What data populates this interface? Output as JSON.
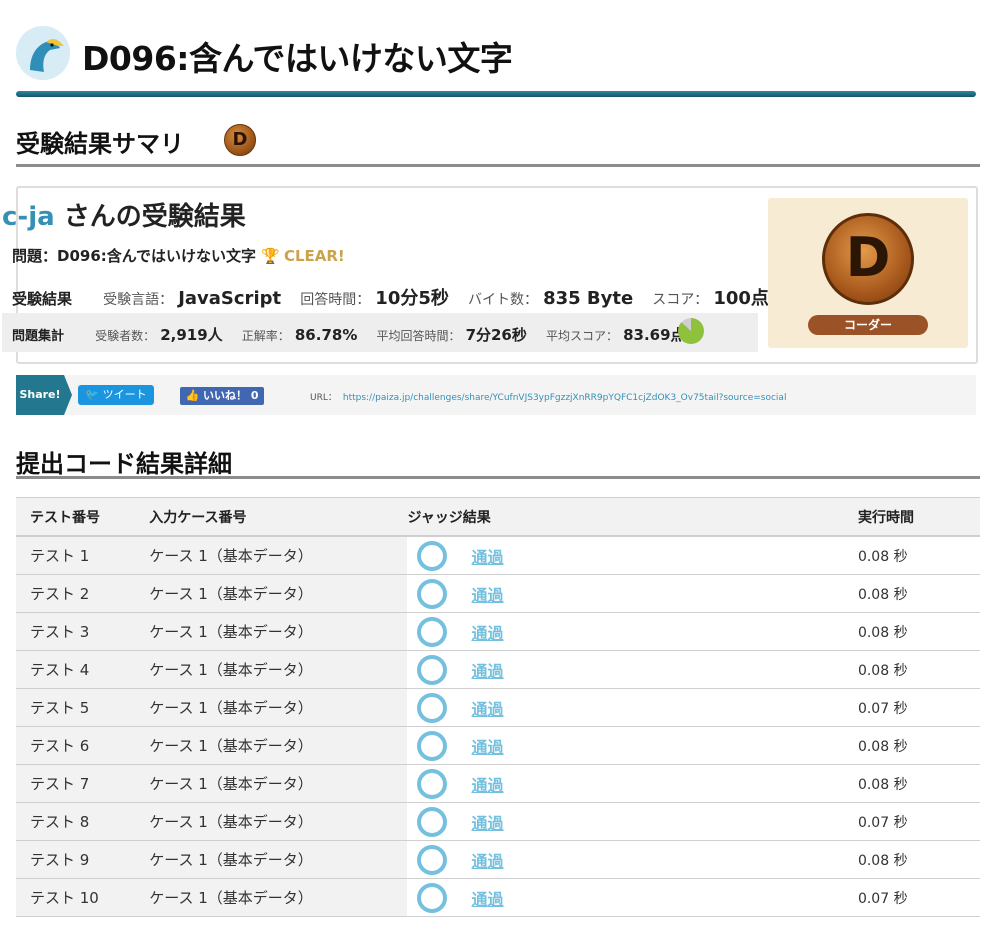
{
  "header": {
    "title": "D096:含んではいけない文字",
    "logo_icon": "paiza-bird-logo-icon"
  },
  "summary": {
    "heading": "受験結果サマリ",
    "rank_letter": "D",
    "user_name": "c-ja",
    "user_suffix": " さんの受験結果",
    "problem_label": "問題：",
    "problem_name": "D096:含んではいけない文字",
    "clear_label": "CLEAR!",
    "result_label": "受験結果",
    "language_label": "受験言語：",
    "language": "JavaScript",
    "time_label": "回答時間：",
    "time": "10分5秒",
    "bytes_label": "バイト数：",
    "bytes": "835 Byte",
    "score_label": "スコア：",
    "score": "100点",
    "aggregate": {
      "label": "問題集計",
      "examinees_label": "受験者数：",
      "examinees": "2,919人",
      "accuracy_label": "正解率：",
      "accuracy": "86.78%",
      "accuracy_value": 86.78,
      "avg_time_label": "平均回答時間：",
      "avg_time": "7分26秒",
      "avg_score_label": "平均スコア：",
      "avg_score": "83.69点"
    },
    "rank_panel": {
      "letter": "D",
      "rank_name": "コーダー"
    }
  },
  "share": {
    "tag": "Share!",
    "tweet": "ツイート",
    "like": "いいね！",
    "like_count": "0",
    "url_label": "URL：",
    "url": "https://paiza.jp/challenges/share/YCufnVJS3ypFgzzjXnRR9pYQFC1cjZdOK3_Ov75tail?source=social"
  },
  "detail": {
    "heading": "提出コード結果詳細",
    "columns": [
      "テスト番号",
      "入力ケース番号",
      "ジャッジ結果",
      "実行時間"
    ],
    "rows": [
      {
        "test": "テスト 1",
        "case": "ケース 1（基本データ）",
        "result": "通過",
        "time": "0.08 秒"
      },
      {
        "test": "テスト 2",
        "case": "ケース 1（基本データ）",
        "result": "通過",
        "time": "0.08 秒"
      },
      {
        "test": "テスト 3",
        "case": "ケース 1（基本データ）",
        "result": "通過",
        "time": "0.08 秒"
      },
      {
        "test": "テスト 4",
        "case": "ケース 1（基本データ）",
        "result": "通過",
        "time": "0.08 秒"
      },
      {
        "test": "テスト 5",
        "case": "ケース 1（基本データ）",
        "result": "通過",
        "time": "0.07 秒"
      },
      {
        "test": "テスト 6",
        "case": "ケース 1（基本データ）",
        "result": "通過",
        "time": "0.08 秒"
      },
      {
        "test": "テスト 7",
        "case": "ケース 1（基本データ）",
        "result": "通過",
        "time": "0.08 秒"
      },
      {
        "test": "テスト 8",
        "case": "ケース 1（基本データ）",
        "result": "通過",
        "time": "0.07 秒"
      },
      {
        "test": "テスト 9",
        "case": "ケース 1（基本データ）",
        "result": "通過",
        "time": "0.08 秒"
      },
      {
        "test": "テスト 10",
        "case": "ケース 1（基本データ）",
        "result": "通過",
        "time": "0.07 秒"
      }
    ]
  },
  "colors": {
    "accent": "#3590b6",
    "pass": "#74c0de",
    "clear": "#caa44a",
    "share": "#23788f"
  }
}
